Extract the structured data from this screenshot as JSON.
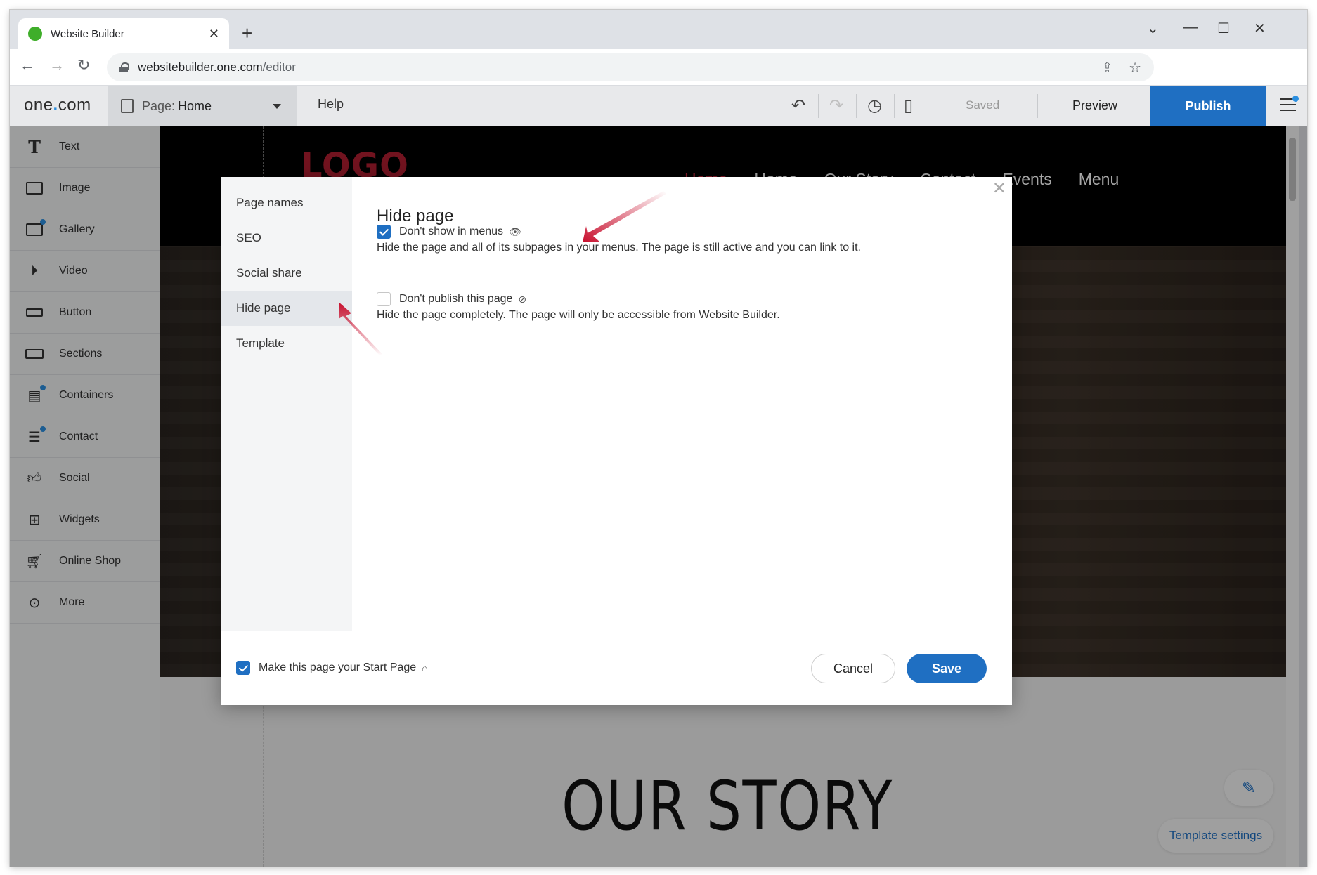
{
  "browser": {
    "tab_title": "Website Builder",
    "url_host": "websitebuilder.one.com",
    "url_path": "/editor"
  },
  "toolbar": {
    "brand_text_a": "one",
    "brand_text_dot": ".",
    "brand_text_b": "com",
    "page_label": "Page:",
    "page_name": "Home",
    "help_label": "Help",
    "saved_label": "Saved",
    "preview_label": "Preview",
    "publish_label": "Publish"
  },
  "sidebar": {
    "items": [
      {
        "label": "Text",
        "icon": "text-icon"
      },
      {
        "label": "Image",
        "icon": "image-icon"
      },
      {
        "label": "Gallery",
        "icon": "gallery-icon"
      },
      {
        "label": "Video",
        "icon": "video-icon"
      },
      {
        "label": "Button",
        "icon": "button-icon"
      },
      {
        "label": "Sections",
        "icon": "sections-icon"
      },
      {
        "label": "Containers",
        "icon": "containers-icon"
      },
      {
        "label": "Contact",
        "icon": "contact-icon"
      },
      {
        "label": "Social",
        "icon": "social-icon"
      },
      {
        "label": "Widgets",
        "icon": "widgets-icon"
      },
      {
        "label": "Online Shop",
        "icon": "cart-icon"
      },
      {
        "label": "More",
        "icon": "more-icon"
      }
    ]
  },
  "site": {
    "logo": "LOGO",
    "nav": [
      "Home",
      "Home",
      "Our Story",
      "Contact",
      "Events",
      "Menu"
    ],
    "story_heading": "OUR STORY"
  },
  "canvas_buttons": {
    "template_settings": "Template settings"
  },
  "modal": {
    "nav": [
      "Page names",
      "SEO",
      "Social share",
      "Hide page",
      "Template"
    ],
    "active_nav": "Hide page",
    "title": "Hide page",
    "option1": {
      "label": "Don't show in menus",
      "checked": true,
      "description": "Hide the page and all of its subpages in your menus. The page is still active and you can link to it."
    },
    "option2": {
      "label": "Don't publish this page",
      "checked": false,
      "description": "Hide the page completely. The page will only be accessible from Website Builder."
    },
    "footer": {
      "start_page_label": "Make this page your Start Page",
      "start_page_checked": true,
      "cancel_label": "Cancel",
      "save_label": "Save"
    }
  },
  "colors": {
    "accent": "#1f6fc2",
    "logo_red": "#b01e30",
    "annotation_arrow": "#c8102e"
  }
}
